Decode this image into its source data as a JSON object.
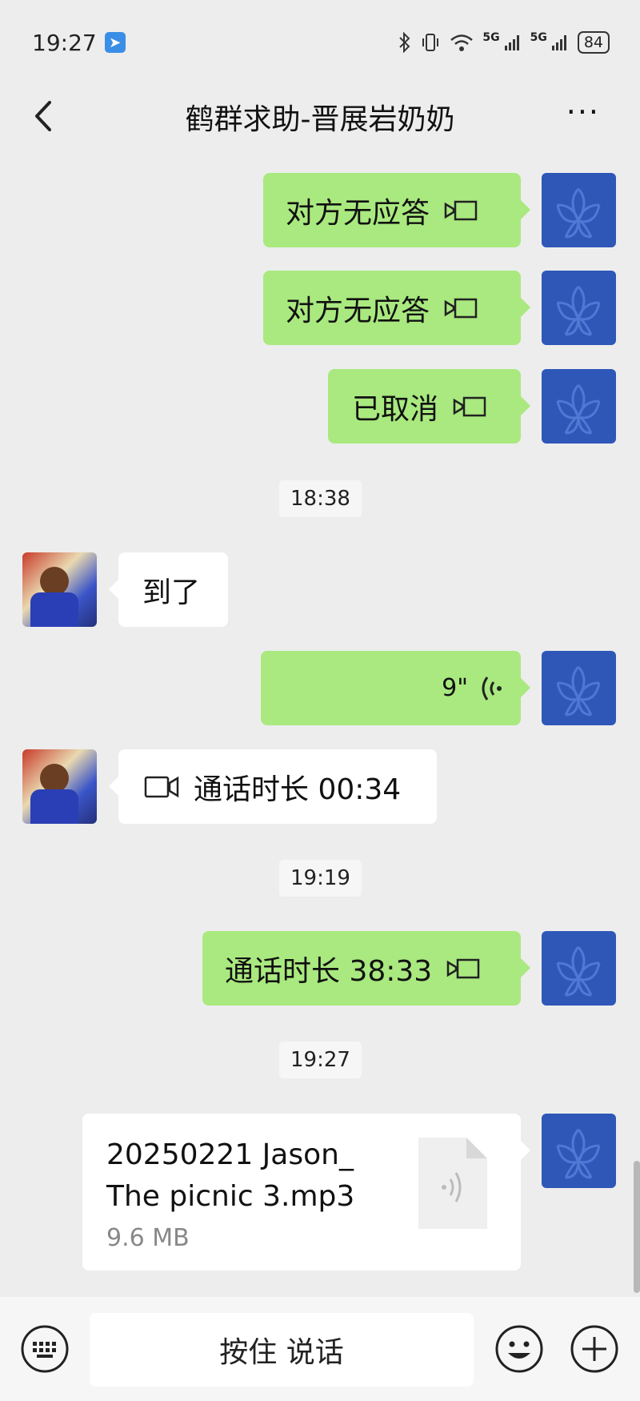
{
  "status_bar": {
    "time": "19:27",
    "network": "5G",
    "network2": "5G",
    "battery": "84"
  },
  "nav": {
    "title": "鹤群求助-晋展岩奶奶"
  },
  "messages": [
    {
      "sender": "me",
      "type": "call",
      "text": "对方无应答"
    },
    {
      "sender": "me",
      "type": "call",
      "text": "对方无应答"
    },
    {
      "sender": "me",
      "type": "call",
      "text": "已取消"
    },
    {
      "type": "timestamp",
      "text": "18:38"
    },
    {
      "sender": "other",
      "type": "text",
      "text": "到了"
    },
    {
      "sender": "me",
      "type": "voice",
      "text": "9\""
    },
    {
      "sender": "other",
      "type": "video-call",
      "text": "通话时长 00:34"
    },
    {
      "type": "timestamp",
      "text": "19:19"
    },
    {
      "sender": "me",
      "type": "call",
      "text": "通话时长 38:33"
    },
    {
      "type": "timestamp",
      "text": "19:27"
    },
    {
      "sender": "me",
      "type": "file",
      "file_name": "20250221 Jason_ The picnic 3.mp3",
      "file_size": "9.6 MB"
    }
  ],
  "input_bar": {
    "hold_to_talk": "按住 说话"
  },
  "colors": {
    "my_bubble": "#a9e97f",
    "other_bubble": "#ffffff",
    "background": "#ededed",
    "my_avatar": "#2e57b8"
  }
}
